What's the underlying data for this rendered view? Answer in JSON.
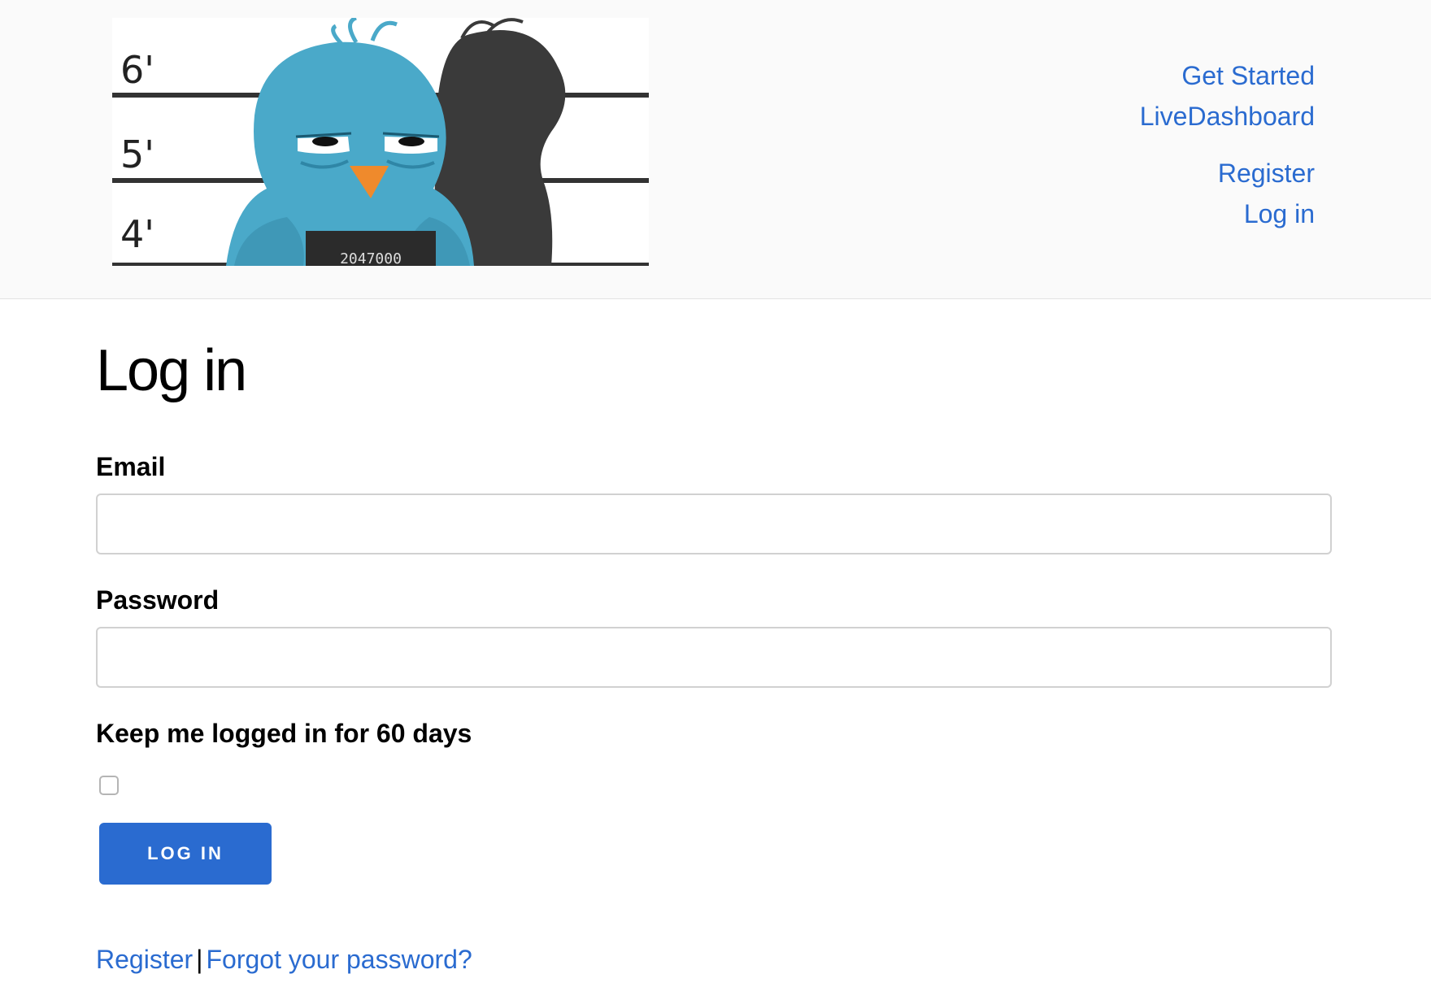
{
  "header": {
    "logo": {
      "height_marks": [
        "6'",
        "5'",
        "4'"
      ],
      "placard_text": "2047000",
      "colors": {
        "bird_body": "#4aa9c9",
        "bird_shadow": "#3a3a3a",
        "beak": "#ef8a2c",
        "lines": "#333333"
      }
    },
    "nav": {
      "get_started": "Get Started",
      "live_dashboard": "LiveDashboard",
      "register": "Register",
      "log_in": "Log in"
    }
  },
  "main": {
    "title": "Log in",
    "email": {
      "label": "Email",
      "value": "",
      "placeholder": ""
    },
    "password": {
      "label": "Password",
      "value": "",
      "placeholder": ""
    },
    "remember_me": {
      "label": "Keep me logged in for 60 days",
      "checked": false
    },
    "submit_label": "LOG IN",
    "footer": {
      "register": "Register",
      "separator": "|",
      "forgot_password": "Forgot your password?"
    }
  },
  "colors": {
    "accent": "#2a6bd0",
    "header_bg": "#fafafa",
    "input_border": "#d1d1d1"
  }
}
